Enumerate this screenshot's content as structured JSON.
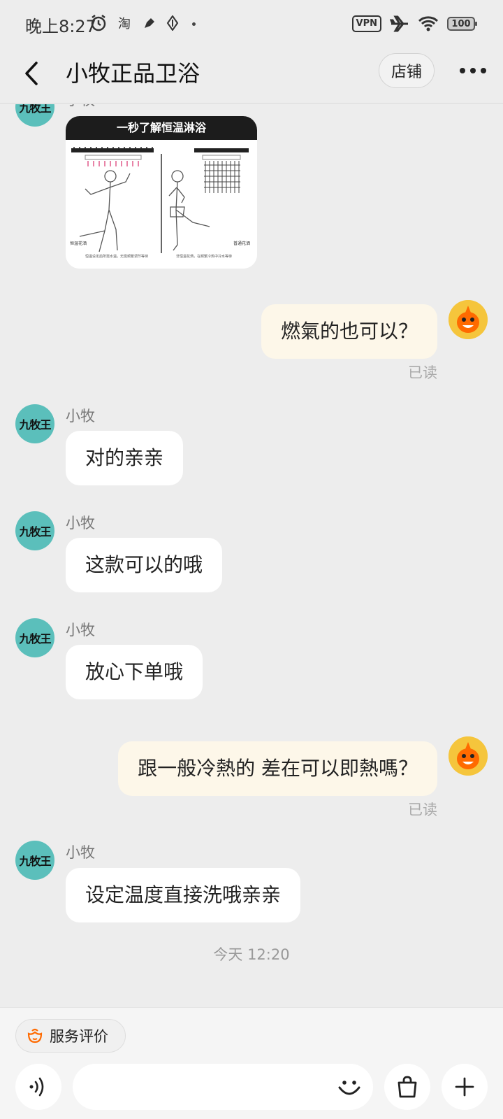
{
  "status_bar": {
    "time": "晚上8:27",
    "vpn": "VPN",
    "battery": "100"
  },
  "header": {
    "title": "小牧正品卫浴",
    "store_label": "店铺"
  },
  "shop_avatar_text": "九牧王",
  "sender_name": "小牧",
  "image_card": {
    "title": "一秒了解恒温淋浴",
    "left_label": "恒温花洒",
    "right_label": "普通花洒",
    "left_caption": "恒温设定后所需水温，无需频繁调节等待",
    "right_caption": "非恒温花洒，在频繁冷热中冷水等待"
  },
  "messages": [
    {
      "side": "out",
      "text": "燃氣的也可以？",
      "status": "已读"
    },
    {
      "side": "in",
      "sender": "小牧",
      "text": "对的亲亲"
    },
    {
      "side": "in",
      "sender": "小牧",
      "text": "这款可以的哦"
    },
    {
      "side": "in",
      "sender": "小牧",
      "text": "放心下单哦"
    },
    {
      "side": "out",
      "text": "跟一般冷熱的 差在可以即熱嗎？",
      "status": "已读"
    },
    {
      "side": "in",
      "sender": "小牧",
      "text": "设定温度直接洗哦亲亲"
    }
  ],
  "timestamp": "今天 12:20",
  "bottom_bar": {
    "service_label": "服务评价",
    "input_placeholder": ""
  },
  "colors": {
    "background": "#ededed",
    "outgoing_bubble": "#fdf7e9",
    "incoming_bubble": "#ffffff",
    "shop_avatar": "#5bbfbb",
    "user_avatar": "#f5c53c",
    "accent_orange": "#ff6a00"
  }
}
